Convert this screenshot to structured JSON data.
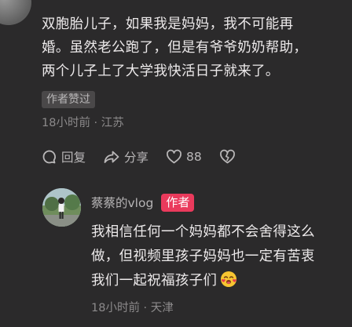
{
  "comment": {
    "lines": [
      "双胞胎儿子，如果我是妈妈，我不可能再",
      "婚。虽然老公跑了，但是有爷爷奶奶帮助，",
      "两个儿子上了大学我快活日子就来了。"
    ],
    "liked_badge": "作者赞过",
    "time": "18小时前",
    "separator": " · ",
    "location": "江苏",
    "actions": {
      "reply_label": "回复",
      "share_label": "分享",
      "like_count": "88"
    }
  },
  "reply": {
    "author_name": "蔡蔡的vlog",
    "author_badge": "作者",
    "lines": [
      "我相信任何一个妈妈都不会舍得这么",
      "做，但视频里孩子妈妈也一定有苦衷",
      "我们一起祝福孩子们"
    ],
    "emoji": "smiling-face-with-hearts-emoji",
    "time": "18小时前",
    "separator": " · ",
    "location": "天津"
  },
  "colors": {
    "background": "#2b2a2b",
    "author_badge": "#ea3a5c",
    "primary_text": "#ece9ea",
    "secondary_text": "#8c8a8b"
  }
}
